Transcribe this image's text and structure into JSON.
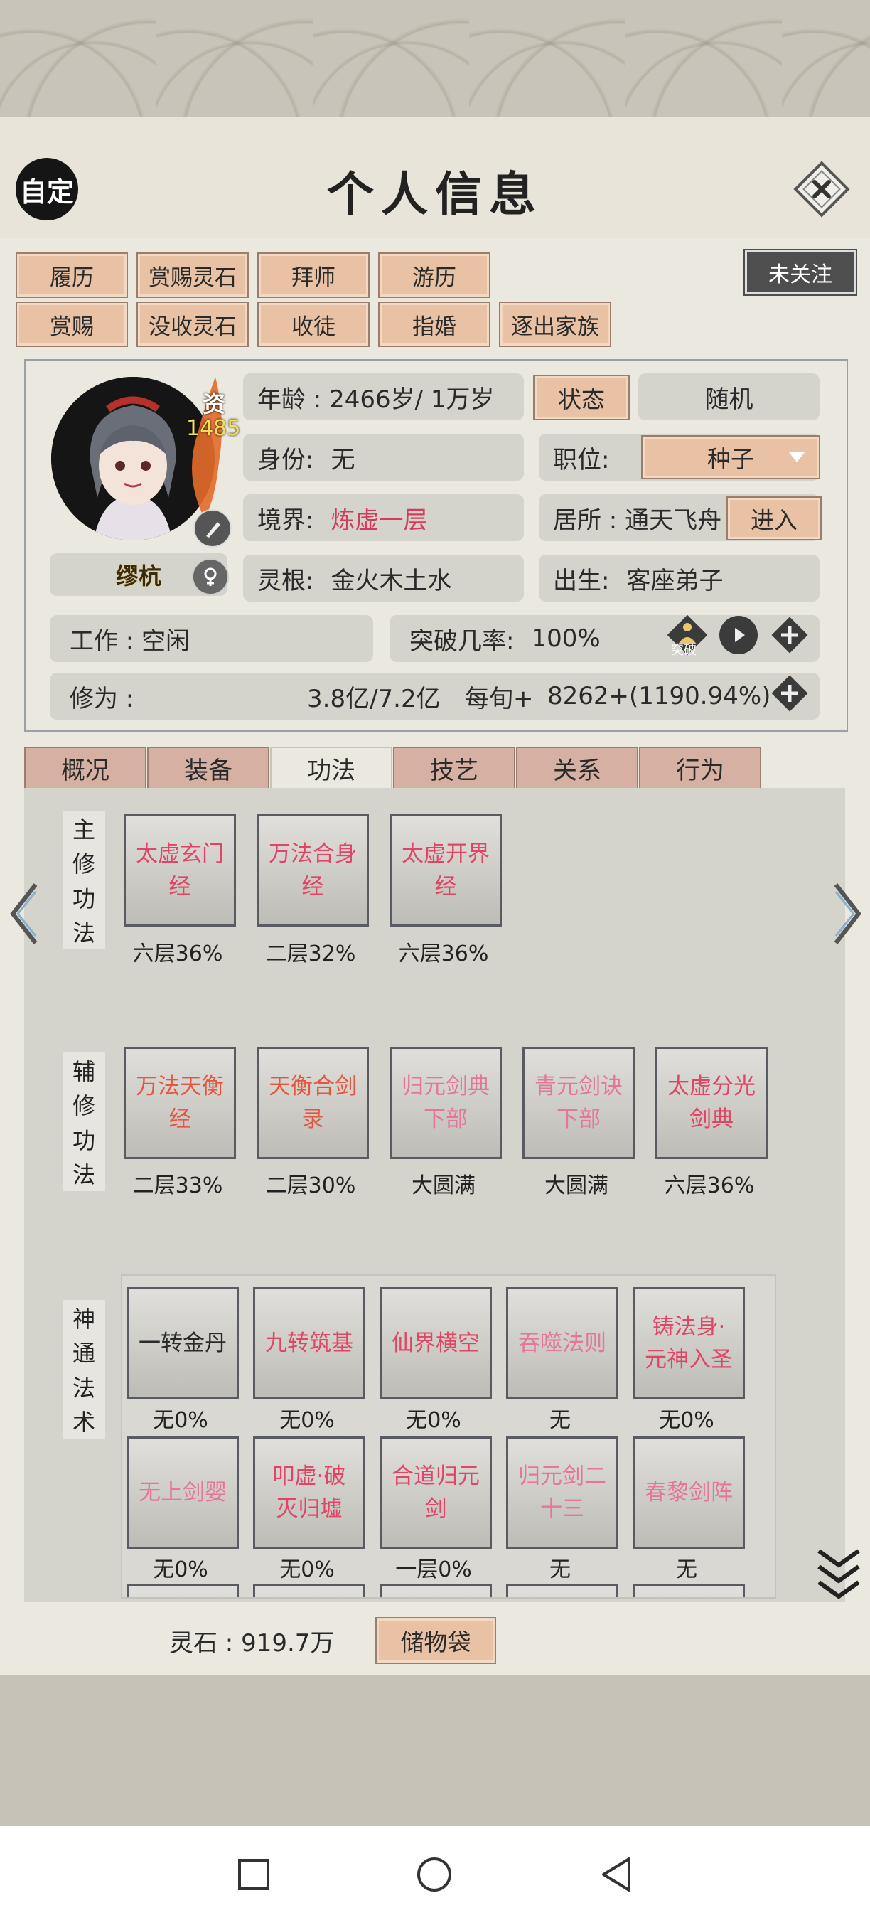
{
  "header": {
    "zoom_label": "自定",
    "title": "个人信息",
    "follow_label": "未关注"
  },
  "actions": {
    "row1": [
      "履历",
      "赏赐灵石",
      "拜师",
      "游历"
    ],
    "row2": [
      "赏赐",
      "没收灵石",
      "收徒",
      "指婚",
      "逐出家族"
    ]
  },
  "profile": {
    "aptitude_label": "资",
    "aptitude_value": "1485",
    "name": "缪杭",
    "gender_icon": "female-icon",
    "age": "年龄 : 2466岁/ 1万岁",
    "status_btn": "状态",
    "random_btn": "随机",
    "identity_label": "身份:",
    "identity_value": "无",
    "position_label": "职位:",
    "position_value": "种子",
    "realm_label": "境界:",
    "realm_value": "炼虚一层",
    "residence": "居所 : 通天飞舟",
    "enter_btn": "进入",
    "root_label": "灵根:",
    "root_value": "金火木土水",
    "birth_label": "出生:",
    "birth_value": "客座弟子",
    "work": "工作 : 空闲",
    "breakthrough_label": "突破几率:",
    "breakthrough_value": "100%",
    "breakthrough_icon_text": "突破",
    "cultivation_label": "修为 :",
    "cultivation_value": "3.8亿/7.2亿",
    "per_turn_label": "每旬+",
    "per_turn_value": "8262+(1190.94%)"
  },
  "tabs": [
    "概况",
    "装备",
    "功法",
    "技艺",
    "关系",
    "行为"
  ],
  "active_tab": "功法",
  "main_skills": {
    "label": [
      "主",
      "修",
      "功",
      "法"
    ],
    "items": [
      {
        "name": "太虚玄门经",
        "level": "六层36%"
      },
      {
        "name": "万法合身经",
        "level": "二层32%"
      },
      {
        "name": "太虚开界经",
        "level": "六层36%"
      }
    ]
  },
  "aux_skills": {
    "label": [
      "辅",
      "修",
      "功",
      "法"
    ],
    "items": [
      {
        "name": "万法天衡经",
        "level": "二层33%"
      },
      {
        "name": "天衡合剑录",
        "level": "二层30%"
      },
      {
        "name": "归元剑典下部",
        "level": "大圆满"
      },
      {
        "name": "青元剑诀下部",
        "level": "大圆满"
      },
      {
        "name": "太虚分光剑典",
        "level": "六层36%"
      }
    ]
  },
  "spells": {
    "label": [
      "神",
      "通",
      "法",
      "术"
    ],
    "items": [
      {
        "name": "一转金丹",
        "level": "无0%"
      },
      {
        "name": "九转筑基",
        "level": "无0%"
      },
      {
        "name": "仙界横空",
        "level": "无0%"
      },
      {
        "name": "吞噬法则",
        "level": "无"
      },
      {
        "name": "铸法身·元神入圣",
        "level": "无0%"
      },
      {
        "name": "无上剑婴",
        "level": "无0%"
      },
      {
        "name": "叩虚·破灭归墟",
        "level": "无0%"
      },
      {
        "name": "合道归元剑",
        "level": "一层0%"
      },
      {
        "name": "归元剑二十三",
        "level": "无"
      },
      {
        "name": "春黎剑阵",
        "level": "无"
      }
    ]
  },
  "footer": {
    "spirit_stone": "灵石 : 919.7万",
    "bag_btn": "储物袋"
  },
  "colors": {
    "accent_red": "#d23d5e",
    "button_peach": "#e9c2a6",
    "pill_gray": "#d4d3cc"
  }
}
